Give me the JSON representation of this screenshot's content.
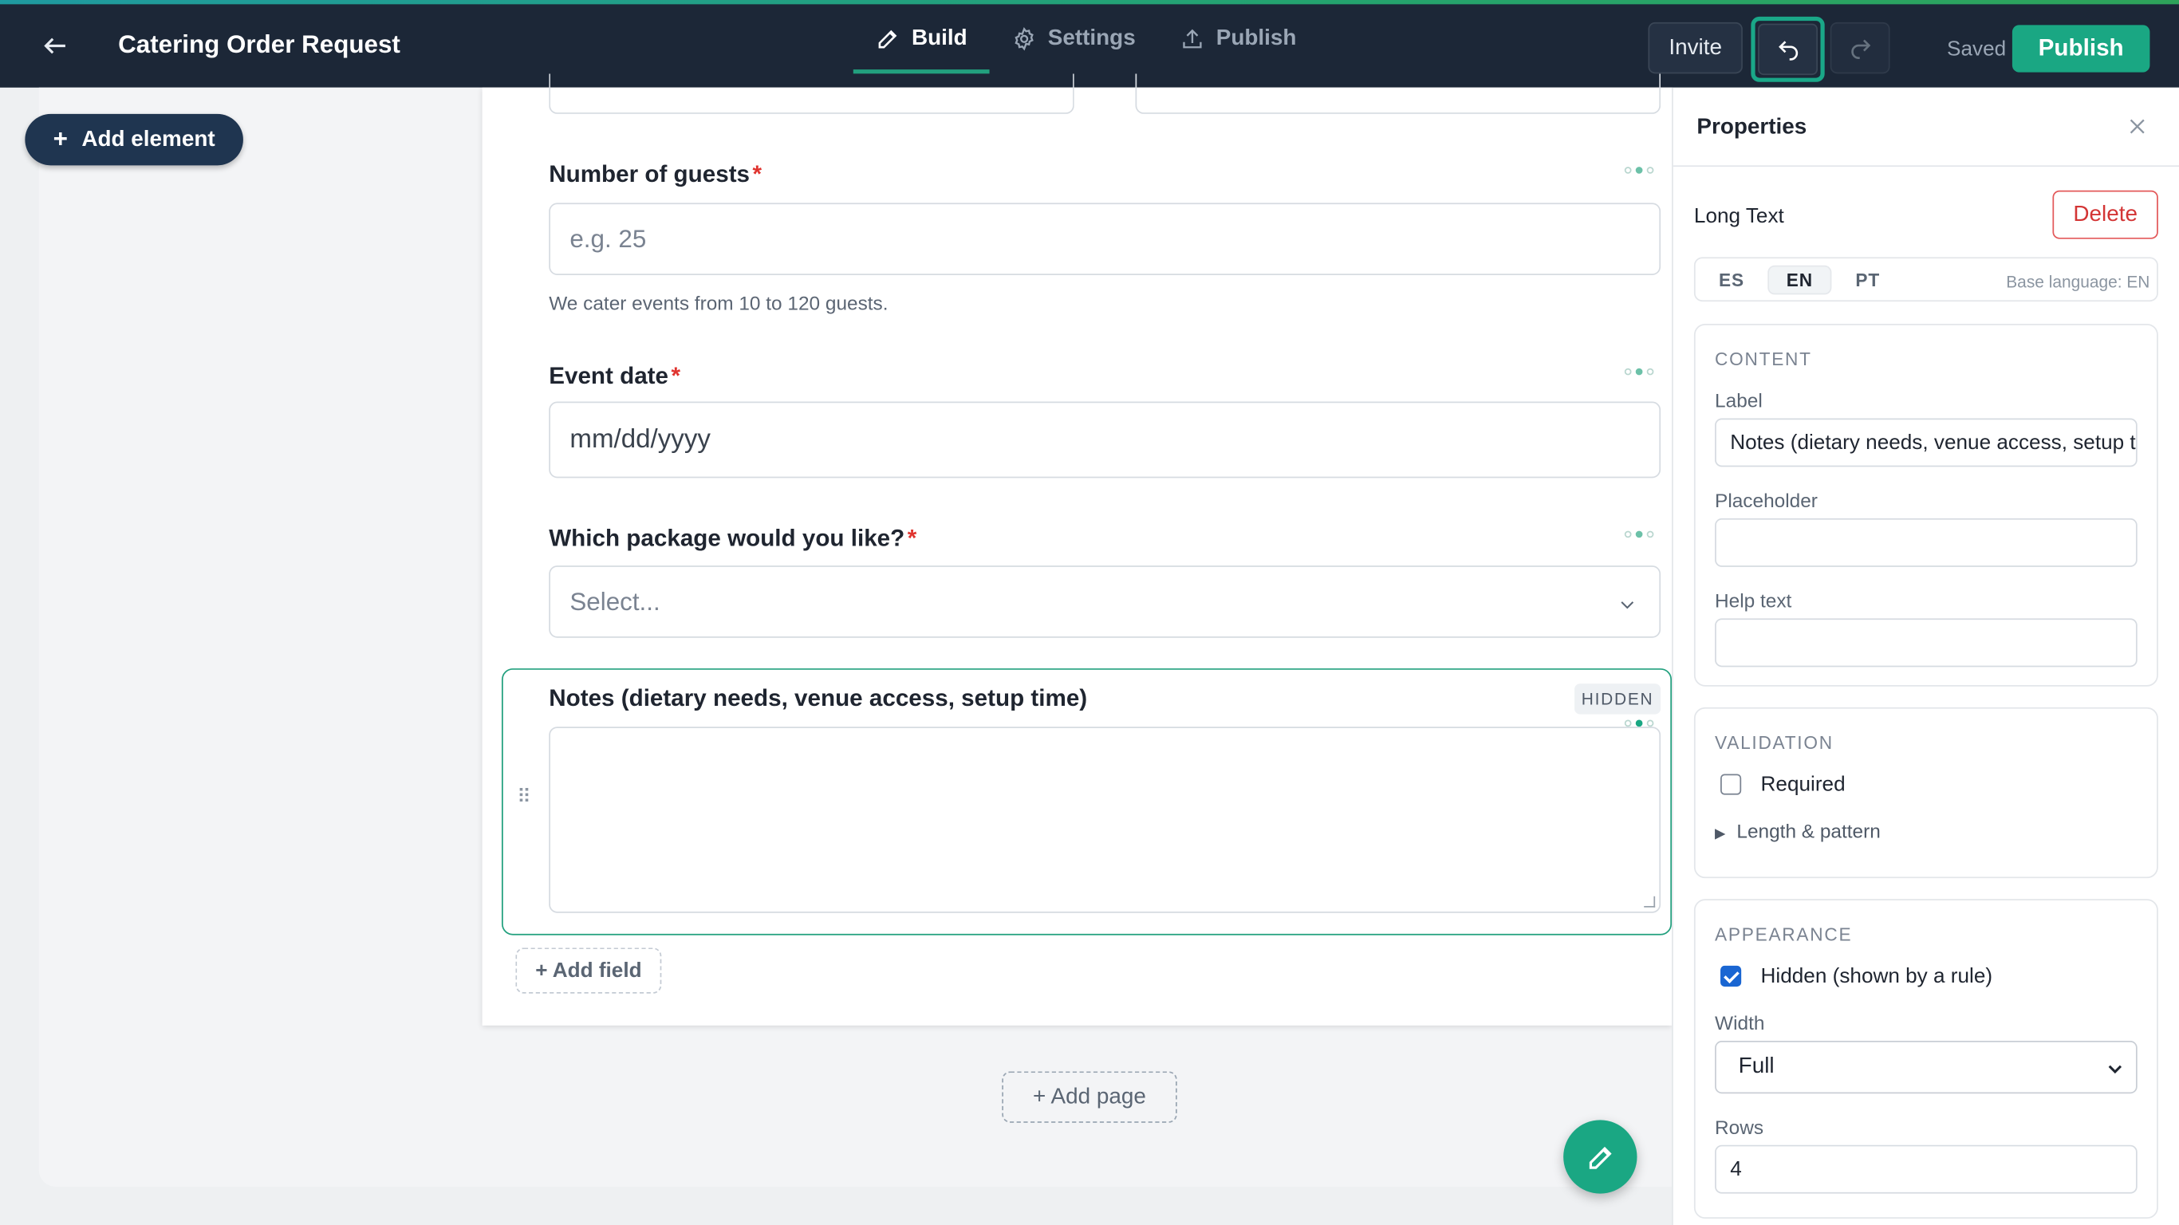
{
  "header": {
    "title": "Catering Order Request",
    "tabs": [
      {
        "label": "Build",
        "icon": "pencil-icon",
        "active": true
      },
      {
        "label": "Settings",
        "icon": "gear-icon",
        "active": false
      },
      {
        "label": "Publish",
        "icon": "upload-icon",
        "active": false
      }
    ],
    "invite_label": "Invite",
    "saved_label": "Saved",
    "publish_label": "Publish",
    "accent_color": "#1aa783"
  },
  "canvas": {
    "add_element_label": "Add element",
    "add_field_label": "+ Add field",
    "add_page_label": "+ Add page",
    "fields": [
      {
        "label": "Number of guests",
        "required": true,
        "placeholder": "e.g. 25",
        "help": "We cater events from 10 to 120 guests."
      },
      {
        "label": "Event date",
        "required": true,
        "placeholder": "mm/dd/yyyy"
      },
      {
        "label": "Which package would you like?",
        "required": true,
        "placeholder": "Select..."
      },
      {
        "label": "Notes (dietary needs, venue access, setup time)",
        "required": false,
        "badge": "HIDDEN",
        "selected": true
      }
    ]
  },
  "properties": {
    "title": "Properties",
    "element_type": "Long Text",
    "delete_label": "Delete",
    "languages": [
      "ES",
      "EN",
      "PT"
    ],
    "active_language": "EN",
    "base_language": "Base language: EN",
    "content": {
      "title": "CONTENT",
      "label_label": "Label",
      "label_value": "Notes (dietary needs, venue access, setup time)",
      "placeholder_label": "Placeholder",
      "placeholder_value": "",
      "help_label": "Help text",
      "help_value": ""
    },
    "validation": {
      "title": "VALIDATION",
      "required_label": "Required",
      "required_checked": false,
      "length_pattern_label": "Length & pattern"
    },
    "appearance": {
      "title": "APPEARANCE",
      "hidden_label": "Hidden (shown by a rule)",
      "hidden_checked": true,
      "width_label": "Width",
      "width_value": "Full",
      "rows_label": "Rows",
      "rows_value": "4"
    }
  }
}
